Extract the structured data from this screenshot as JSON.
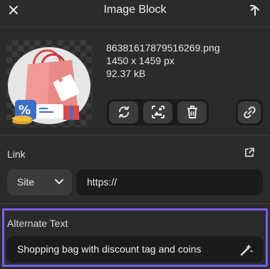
{
  "header": {
    "title": "Image Block",
    "close_icon": "close-icon",
    "back_icon": "arrow-up-icon"
  },
  "image": {
    "filename": "86381617879516269.png",
    "dimensions": "1450 x 1459 px",
    "filesize": "92.37 kB",
    "preview_icon": "shopping-bag-illustration"
  },
  "actions": {
    "replace_icon": "replace-icon",
    "edit_icon": "image-edit-icon",
    "delete_icon": "trash-icon",
    "link_icon": "chain-link-icon"
  },
  "link": {
    "label": "Link",
    "open_icon": "external-link-icon",
    "type_value": "Site",
    "url_value": "https://"
  },
  "alt_text": {
    "label": "Alternate Text",
    "value": "Shopping bag with discount tag and coins",
    "magic_icon": "magic-wand-icon"
  },
  "colors": {
    "background": "#2b2b2b",
    "input_background": "#1b1b1b",
    "button_background": "#3c3c3c",
    "highlight": "#7b5cf0"
  }
}
